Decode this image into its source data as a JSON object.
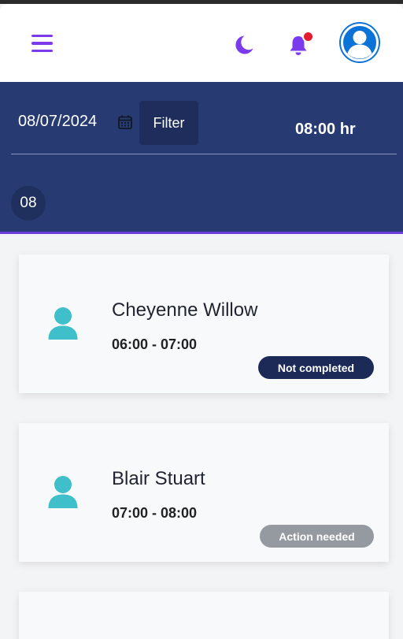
{
  "topbar": {
    "menu_icon": "hamburger-icon",
    "theme_icon": "moon-icon",
    "notification_icon": "bell-icon",
    "profile_icon": "user-avatar-icon",
    "accent_color": "#7c3aed",
    "notification_dot_color": "#e11d2e",
    "avatar_color": "#0b73d8"
  },
  "header": {
    "date": "08/07/2024",
    "calendar_icon": "calendar-icon",
    "filter_label": "Filter",
    "total_hours": "08:00 hr",
    "hour_chip": "08",
    "background_color": "#273b72",
    "accent_line_color": "#6d3fd9"
  },
  "appointments": [
    {
      "name": "Cheyenne Willow",
      "time": "06:00 - 07:00",
      "status": "Not completed",
      "status_color": "#1c2a57",
      "icon": "person-icon"
    },
    {
      "name": "Blair Stuart",
      "time": "07:00 - 08:00",
      "status": "Action needed",
      "status_color": "#959aa0",
      "icon": "person-icon"
    }
  ]
}
